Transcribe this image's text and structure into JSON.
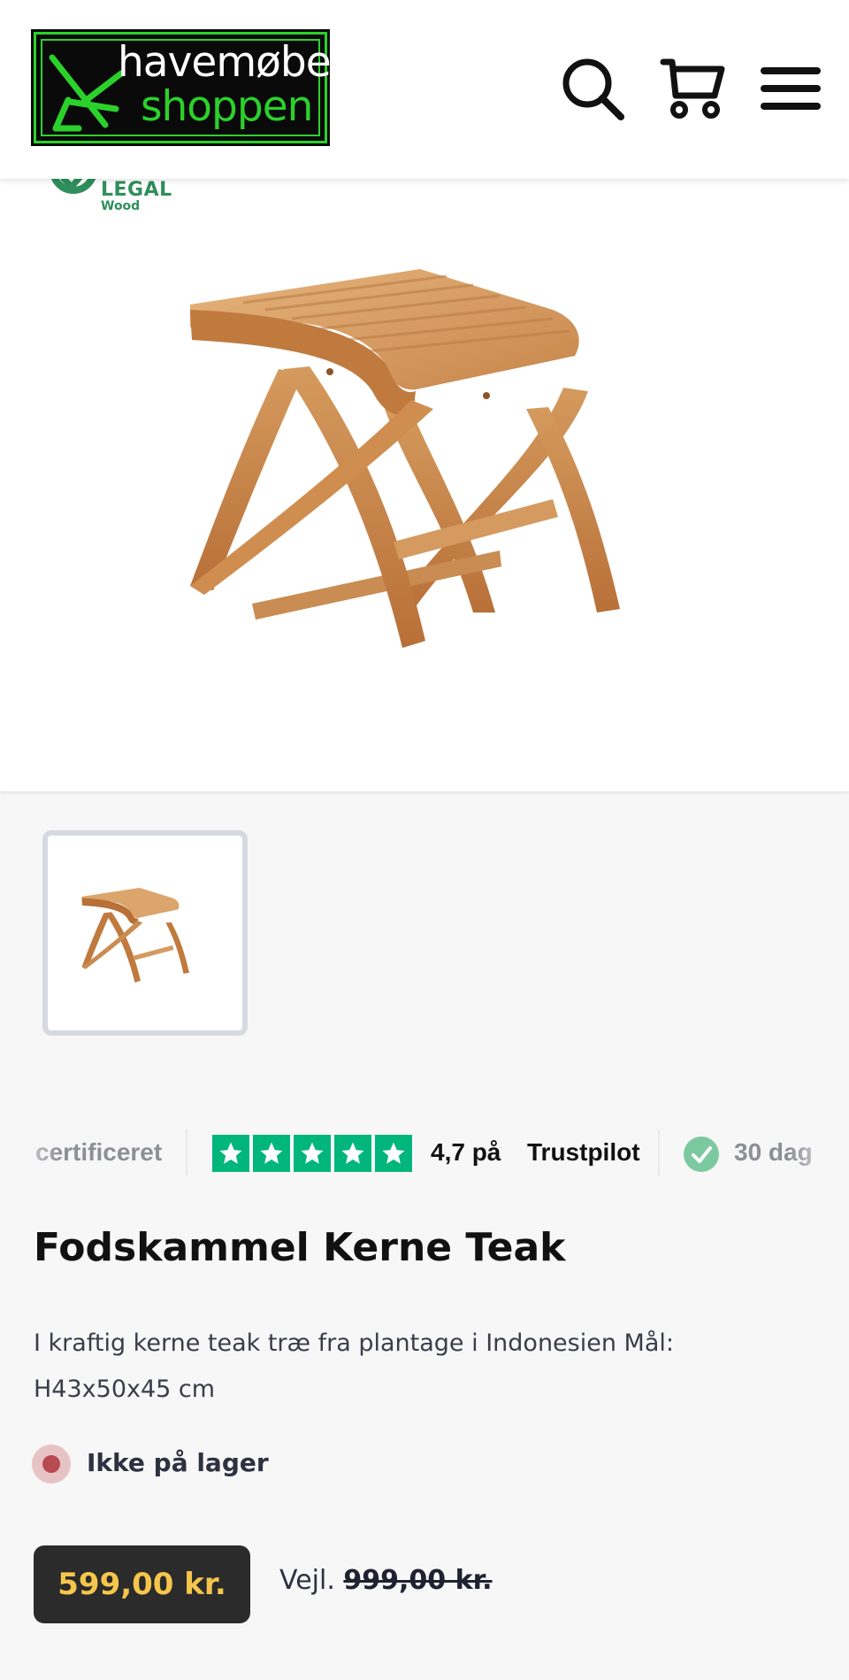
{
  "header": {
    "logo_line1": "havemøbel",
    "logo_line2": "shoppen",
    "icons": [
      "search-icon",
      "cart-icon",
      "menu-icon"
    ],
    "colors": {
      "logo_bg": "#0a0a0a",
      "logo_accent": "#2bd12b",
      "icon": "#111111"
    }
  },
  "badge": {
    "title": "LEGAL",
    "subtitle": "Wood",
    "color": "#2f8f5c"
  },
  "trust_bar": {
    "left_text": "certificeret",
    "rating_text": "4,7 på",
    "provider": "Trustpilot",
    "right_text": "30 dag",
    "star_count": 5,
    "star_color": "#00b67a"
  },
  "product": {
    "title": "Fodskammel Kerne Teak",
    "description": "I kraftig kerne teak træ fra plantage i Indonesien Mål: H43x50x45 cm",
    "stock_status": "Ikke på lager",
    "price": "599,00 kr.",
    "rrp_label": "Vejl.",
    "rrp_value": "999,00 kr.",
    "colors": {
      "price_bg": "#2b2b2b",
      "price_text": "#f5c64b",
      "stock_dot": "#b84a52"
    }
  }
}
